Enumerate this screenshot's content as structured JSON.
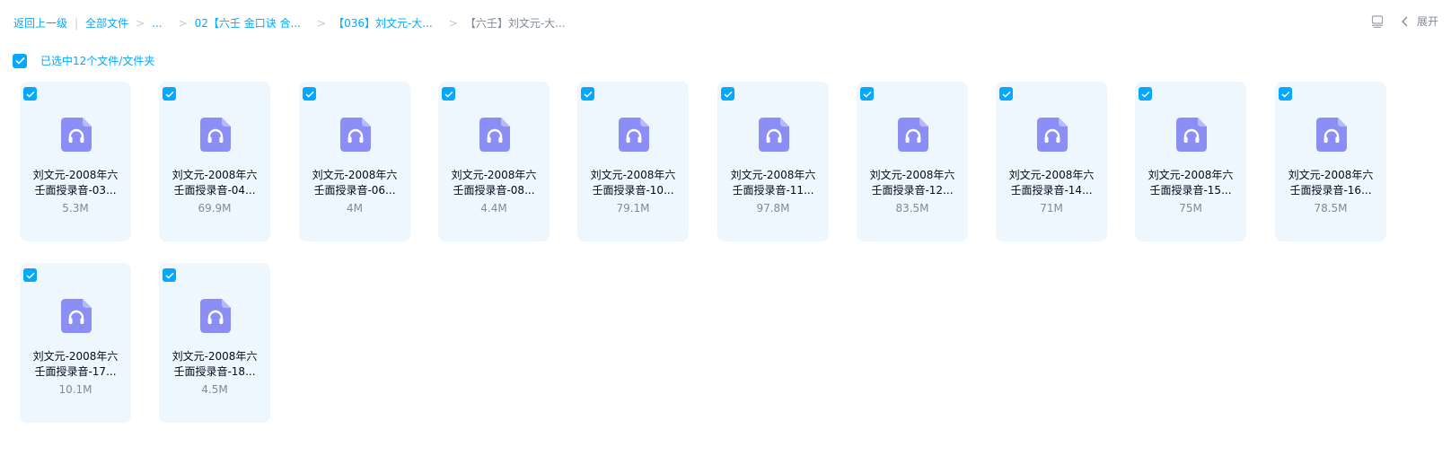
{
  "breadcrumb": {
    "back": "返回上一级",
    "all_files": "全部文件",
    "ellipsis": "...",
    "level1": "02【六壬 金口诀 合...",
    "level2": "【036】刘文元-大...",
    "current": "【六壬】刘文元-大..."
  },
  "toolbar": {
    "expand_label": "展开",
    "view_icon": "list-view-icon",
    "collapse_icon": "chevron-left-icon"
  },
  "selection": {
    "label": "已选中12个文件/文件夹"
  },
  "colors": {
    "accent": "#06a7ff",
    "card_bg": "#eef7fd",
    "audio_icon": "#8b8ef5"
  },
  "files": [
    {
      "name_line1": "刘文元-2008年六",
      "name_line2": "壬面授录音-03...",
      "size": "5.3M"
    },
    {
      "name_line1": "刘文元-2008年六",
      "name_line2": "壬面授录音-04...",
      "size": "69.9M"
    },
    {
      "name_line1": "刘文元-2008年六",
      "name_line2": "壬面授录音-06...",
      "size": "4M"
    },
    {
      "name_line1": "刘文元-2008年六",
      "name_line2": "壬面授录音-08...",
      "size": "4.4M"
    },
    {
      "name_line1": "刘文元-2008年六",
      "name_line2": "壬面授录音-10...",
      "size": "79.1M"
    },
    {
      "name_line1": "刘文元-2008年六",
      "name_line2": "壬面授录音-11...",
      "size": "97.8M"
    },
    {
      "name_line1": "刘文元-2008年六",
      "name_line2": "壬面授录音-12...",
      "size": "83.5M"
    },
    {
      "name_line1": "刘文元-2008年六",
      "name_line2": "壬面授录音-14...",
      "size": "71M"
    },
    {
      "name_line1": "刘文元-2008年六",
      "name_line2": "壬面授录音-15...",
      "size": "75M"
    },
    {
      "name_line1": "刘文元-2008年六",
      "name_line2": "壬面授录音-16...",
      "size": "78.5M"
    },
    {
      "name_line1": "刘文元-2008年六",
      "name_line2": "壬面授录音-17...",
      "size": "10.1M"
    },
    {
      "name_line1": "刘文元-2008年六",
      "name_line2": "壬面授录音-18...",
      "size": "4.5M"
    }
  ]
}
